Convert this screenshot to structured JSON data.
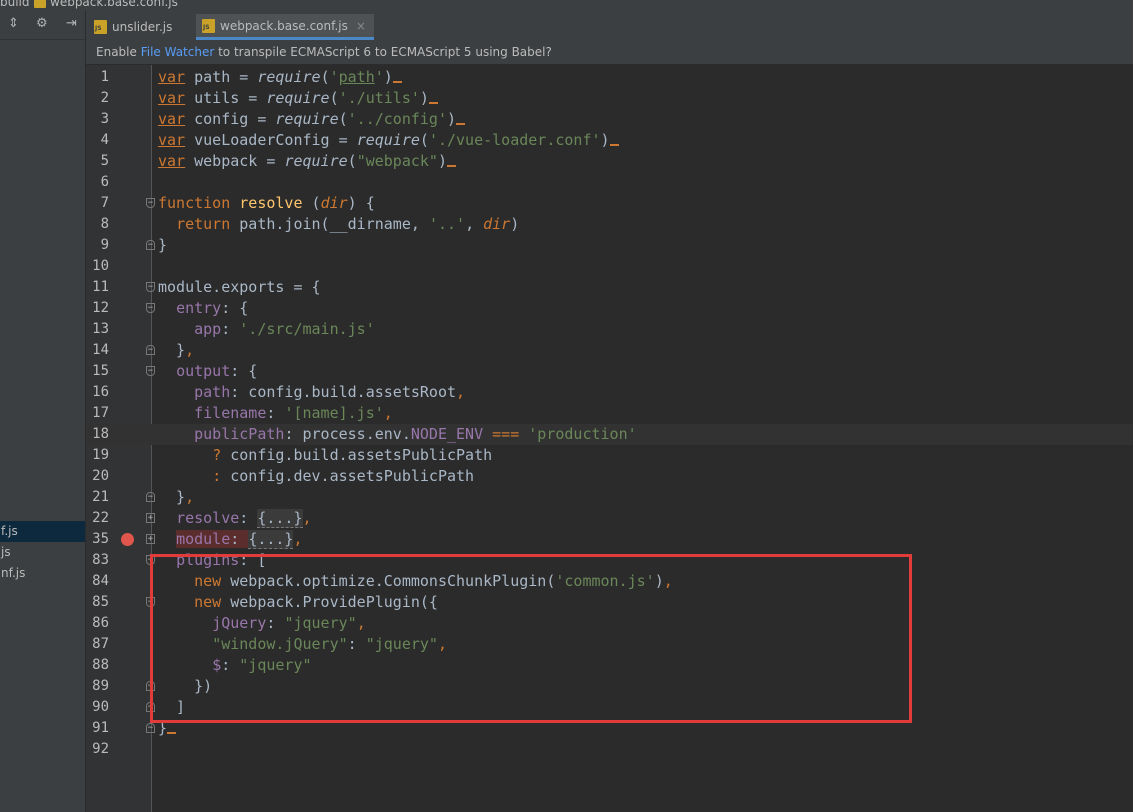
{
  "breadcrumb": {
    "folder": "build",
    "file": "webpack.base.conf.js"
  },
  "left_panel": {
    "toolbar_icons": [
      "collapse-icon",
      "gear-icon",
      "hide-icon"
    ],
    "files": [
      {
        "label": "f.js",
        "selected": true
      },
      {
        "label": "js",
        "selected": false
      },
      {
        "label": "nf.js",
        "selected": false
      }
    ]
  },
  "tabs": [
    {
      "label": "unslider.js",
      "active": false
    },
    {
      "label": "webpack.base.conf.js",
      "active": true
    }
  ],
  "notification": {
    "before": "Enable ",
    "link": "File Watcher",
    "after": " to transpile ECMAScript 6 to ECMAScript 5 using Babel?"
  },
  "code_lines": [
    {
      "n": "1",
      "html": "<span class='kwu'>var</span> path = <span class='itw'>require</span>(<span class='str'>'</span><span class='str' style='text-decoration:underline'>path</span><span class='str'>'</span>)<span class='semi'></span>"
    },
    {
      "n": "2",
      "html": "<span class='kwu'>var</span> utils = <span class='itw'>require</span>(<span class='str'>'./utils'</span>)<span class='semi'></span>"
    },
    {
      "n": "3",
      "html": "<span class='kwu'>var</span> config = <span class='itw'>require</span>(<span class='str'>'../config'</span>)<span class='semi'></span>"
    },
    {
      "n": "4",
      "html": "<span class='kwu'>var</span> vueLoaderConfig = <span class='itw'>require</span>(<span class='str'>'./vue-loader.conf'</span>)<span class='semi'></span>"
    },
    {
      "n": "5",
      "html": "<span class='kwu'>var</span> webpack = <span class='itw'>require</span>(<span class='str'>\"webpack\"</span>)<span class='semi'></span>"
    },
    {
      "n": "6",
      "html": ""
    },
    {
      "n": "7",
      "html": "<span class='kw'>function</span> <span class='fn'>resolve</span> (<span class='it' style='color:#cc7832'>dir</span>) {"
    },
    {
      "n": "8",
      "html": "  <span class='kw'>return</span> path.join(__dirname, <span class='str'>'..'</span>, <span class='it' style='color:#cc7832'>dir</span>)"
    },
    {
      "n": "9",
      "html": "}"
    },
    {
      "n": "10",
      "html": ""
    },
    {
      "n": "11",
      "html": "module.exports = {"
    },
    {
      "n": "12",
      "html": "  <span class='prop'>entry</span>: {"
    },
    {
      "n": "13",
      "html": "    <span class='prop'>app</span>: <span class='str'>'./src/main.js'</span>"
    },
    {
      "n": "14",
      "html": "  }<span class='kw'>,</span>"
    },
    {
      "n": "15",
      "html": "  <span class='prop'>output</span>: {"
    },
    {
      "n": "16",
      "html": "    <span class='prop'>path</span>: config.build.assetsRoot<span class='kw'>,</span>"
    },
    {
      "n": "17",
      "html": "    <span class='prop'>filename</span>: <span class='str'>'[name].js'</span><span class='kw'>,</span>"
    },
    {
      "n": "18",
      "html": "    <span class='prop'>publicPath</span>: process.env.<span class='prop'>NODE_ENV</span> <span class='kw'>===</span> <span class='str'>'production'</span>"
    },
    {
      "n": "19",
      "html": "      <span class='kw'>?</span> config.build.assetsPublicPath"
    },
    {
      "n": "20",
      "html": "      <span class='kw'>:</span> config.dev.assetsPublicPath"
    },
    {
      "n": "21",
      "html": "  }<span class='kw'>,</span>"
    },
    {
      "n": "22",
      "html": "  <span class='prop'>resolve</span>: <span class='fold-box'>{...}</span><span class='kw'>,</span>"
    },
    {
      "n": "35",
      "html": "  <span class='bp-hl'><span class='prop'>module</span>: </span><span class='fold-box'>{...}</span><span class='kw'>,</span>"
    },
    {
      "n": "83",
      "html": "  <span class='prop'>plugins</span>: ["
    },
    {
      "n": "84",
      "html": "    <span class='kw'>new</span> webpack.optimize.CommonsChunkPlugin(<span class='str'>'common.js'</span>)<span class='kw'>,</span>"
    },
    {
      "n": "85",
      "html": "    <span class='kw'>new</span> webpack.ProvidePlugin({"
    },
    {
      "n": "86",
      "html": "      <span class='prop'>jQuery</span>: <span class='str'>\"jquery\"</span><span class='kw'>,</span>"
    },
    {
      "n": "87",
      "html": "      <span class='str'>\"window.jQuery\"</span>: <span class='str'>\"jquery\"</span><span class='kw'>,</span>"
    },
    {
      "n": "88",
      "html": "      <span class='prop'>$</span>: <span class='str'>\"jquery\"</span>"
    },
    {
      "n": "89",
      "html": "    })"
    },
    {
      "n": "90",
      "html": "  ]"
    },
    {
      "n": "91",
      "html": "}<span class='semi'></span>"
    },
    {
      "n": "92",
      "html": ""
    }
  ],
  "current_line": "18",
  "breakpoint_line": "35",
  "fold_markers": {
    "7": "open",
    "9": "close-f",
    "11": "open",
    "12": "open",
    "14": "close-f",
    "15": "open",
    "21": "close-f",
    "22": "plus",
    "35": "plus",
    "83": "open",
    "85": "open",
    "89": "close-f",
    "90": "close-f",
    "91": "close-f"
  },
  "colors": {
    "editor_bg": "#2b2b2b",
    "keyword": "#cc7832",
    "string": "#6a8759",
    "property": "#9876aa",
    "function": "#ffc66d",
    "highlight_box": "#e23c3a",
    "breakpoint": "#e0564d"
  }
}
